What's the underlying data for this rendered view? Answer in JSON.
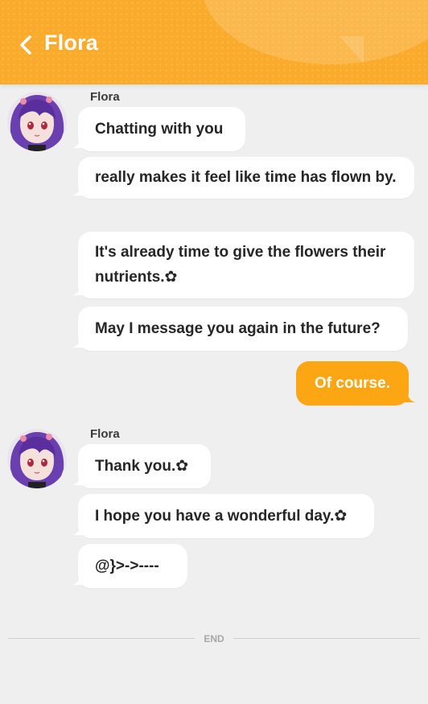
{
  "header": {
    "title": "Flora",
    "back_icon": "chevron-left-icon",
    "background_color": "#fbab2b"
  },
  "messages": [
    {
      "sender": "Flora",
      "bubbles": [
        "Chatting with you",
        "really makes it feel like time has flown by.",
        "It's already time to give the flowers their nutrients.✿",
        "May I message you again in the future?"
      ]
    },
    {
      "sender": "me",
      "bubbles": [
        "Of course."
      ]
    },
    {
      "sender": "Flora",
      "bubbles": [
        "Thank you.✿",
        "I hope you have a wonderful day.✿",
        "@}>->----"
      ]
    }
  ],
  "footer": {
    "end_label": "END"
  },
  "colors": {
    "accent": "#fca614",
    "incoming_bubble": "#ffffff",
    "background": "#efeff0"
  }
}
